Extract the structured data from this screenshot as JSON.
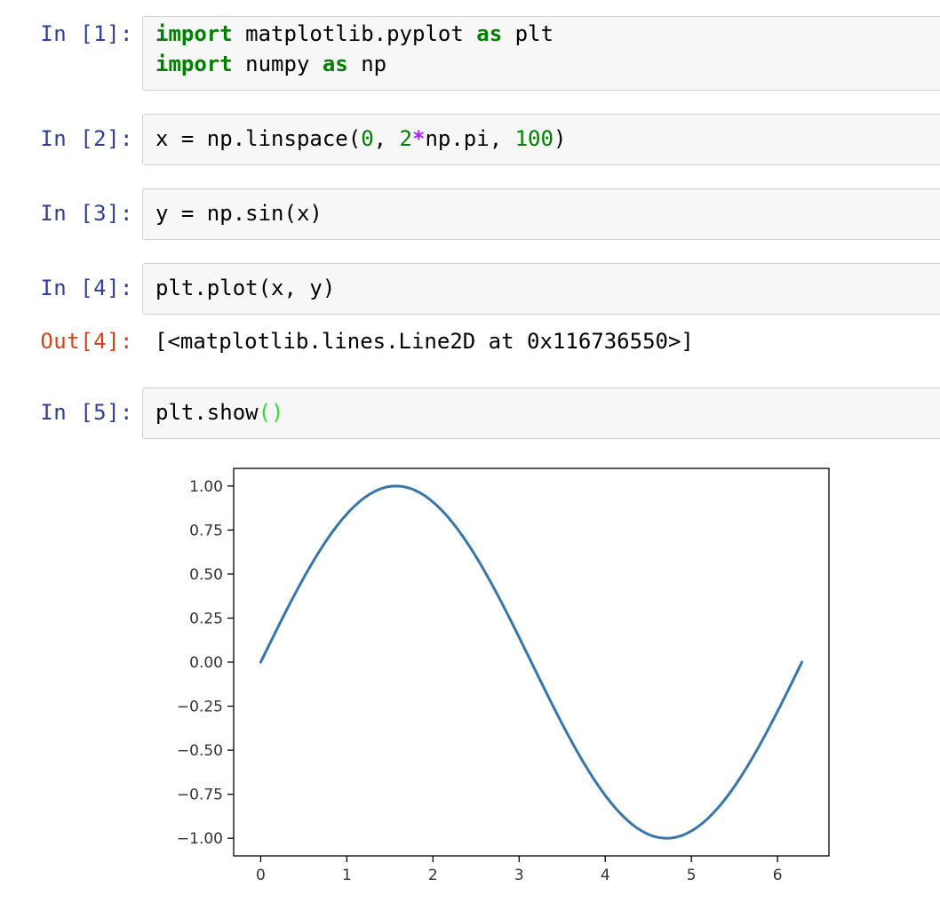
{
  "cells": [
    {
      "prompt": "In [1]:",
      "lines": [
        [
          [
            "kw",
            "import"
          ],
          [
            "t",
            " matplotlib.pyplot "
          ],
          [
            "kw",
            "as"
          ],
          [
            "t",
            " plt"
          ]
        ],
        [
          [
            "kw",
            "import"
          ],
          [
            "t",
            " numpy "
          ],
          [
            "kw",
            "as"
          ],
          [
            "t",
            " np"
          ]
        ]
      ]
    },
    {
      "prompt": "In [2]:",
      "lines": [
        [
          [
            "t",
            "x = np.linspace("
          ],
          [
            "num",
            "0"
          ],
          [
            "t",
            ", "
          ],
          [
            "num",
            "2"
          ],
          [
            "op",
            "*"
          ],
          [
            "t",
            "np.pi, "
          ],
          [
            "num",
            "100"
          ],
          [
            "t",
            ")"
          ]
        ]
      ]
    },
    {
      "prompt": "In [3]:",
      "lines": [
        [
          [
            "t",
            "y = np.sin(x)"
          ]
        ]
      ]
    },
    {
      "prompt": "In [4]:",
      "lines": [
        [
          [
            "t",
            "plt.plot(x, y)"
          ]
        ]
      ]
    },
    {
      "prompt": "In [5]:",
      "lines": [
        [
          [
            "t",
            "plt.show"
          ],
          [
            "paren-hl",
            "()"
          ]
        ]
      ]
    }
  ],
  "output": {
    "prompt": "Out[4]:",
    "text": "[<matplotlib.lines.Line2D at 0x116736550>]"
  },
  "chart_data": {
    "type": "line",
    "title": "",
    "xlabel": "",
    "ylabel": "",
    "xlim": [
      -0.314,
      6.597
    ],
    "ylim": [
      -1.1,
      1.1
    ],
    "x_ticks": [
      "0",
      "1",
      "2",
      "3",
      "4",
      "5",
      "6"
    ],
    "y_ticks": [
      "1.00",
      "0.75",
      "0.50",
      "0.25",
      "0.00",
      "−0.25",
      "−0.50",
      "−0.75",
      "−1.00"
    ],
    "series": [
      {
        "function": "sin",
        "x_start": 0,
        "x_end": 6.283185307179586,
        "points": 100,
        "color": "#3776ab"
      }
    ],
    "grid": false
  }
}
